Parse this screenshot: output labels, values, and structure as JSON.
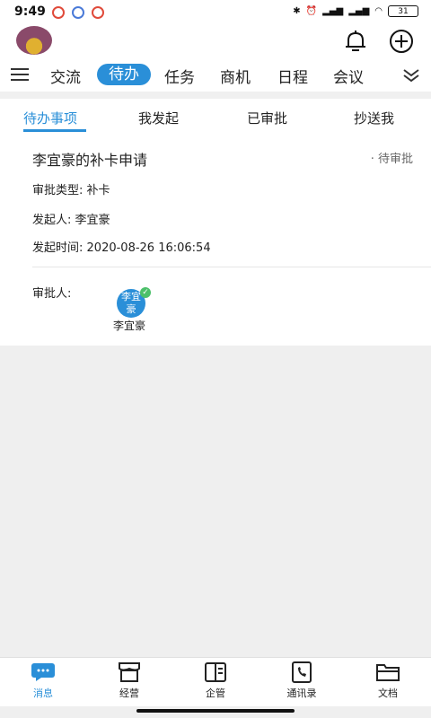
{
  "status_bar": {
    "time": "9:49",
    "battery": "31"
  },
  "top_tabs": [
    "交流",
    "待办",
    "任务",
    "商机",
    "日程",
    "会议"
  ],
  "active_top_tab": "待办",
  "sub_tabs": [
    "待办事项",
    "我发起",
    "已审批",
    "抄送我"
  ],
  "item": {
    "title": "李宜豪的补卡申请",
    "status": "待审批",
    "type_label": "审批类型:",
    "type_value": "补卡",
    "initiator_label": "发起人:",
    "initiator_value": "李宜豪",
    "time_label": "发起时间:",
    "time_value": "2020-08-26 16:06:54",
    "approver_label": "审批人:",
    "approver_avatar_text": "李宜豪",
    "approver_name": "李宜豪"
  },
  "bottom_nav": [
    "消息",
    "经营",
    "企管",
    "通讯录",
    "文档"
  ],
  "colors": {
    "accent": "#2a8fd8",
    "approved": "#4cc06a"
  }
}
